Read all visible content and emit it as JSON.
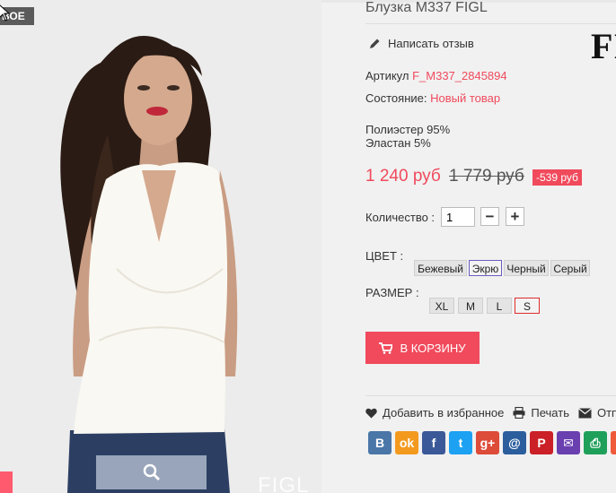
{
  "photo": {
    "badge": "ВОЕ",
    "watermark": "FIGL"
  },
  "product": {
    "title": "Блузка M337 FIGL",
    "brand_logo": "FI",
    "review_label": "Написать отзыв",
    "article_label": "Артикул",
    "article_value": "F_M337_2845894",
    "condition_label": "Состояние:",
    "condition_value": "Новый товар",
    "composition_1": "Полиэстер 95%",
    "composition_2": "Эластан 5%",
    "price_new": "1 240 руб",
    "price_old": "1 779 руб",
    "discount": "-539 руб",
    "qty_label": "Количество :",
    "qty_value": "1",
    "qty_minus": "−",
    "qty_plus": "+",
    "color_label": "ЦВЕТ :",
    "colors": [
      "Бежевый",
      "Экрю",
      "Черный",
      "Серый"
    ],
    "selected_color": "Экрю",
    "size_label": "РАЗМЕР :",
    "sizes": [
      "XL",
      "M",
      "L",
      "S"
    ],
    "selected_size": "S",
    "cart_label": "В КОРЗИНУ"
  },
  "actions": {
    "favorite": "Добавить в избранное",
    "print": "Печать",
    "send": "Отпр"
  },
  "social": [
    {
      "icon": "vk-icon",
      "glyph": "B",
      "color": "#4a76a8"
    },
    {
      "icon": "odnoklassniki-icon",
      "glyph": "ok",
      "color": "#f39a1e"
    },
    {
      "icon": "facebook-icon",
      "glyph": "f",
      "color": "#3b5998"
    },
    {
      "icon": "twitter-icon",
      "glyph": "t",
      "color": "#1da1f2"
    },
    {
      "icon": "google-plus-icon",
      "glyph": "g+",
      "color": "#dd4b39"
    },
    {
      "icon": "mail-ru-icon",
      "glyph": "@",
      "color": "#2c5e9e"
    },
    {
      "icon": "pinterest-icon",
      "glyph": "P",
      "color": "#cb2027"
    },
    {
      "icon": "email-icon",
      "glyph": "✉",
      "color": "#6a3fb0"
    },
    {
      "icon": "print-icon",
      "glyph": "⎙",
      "color": "#1fa05a"
    },
    {
      "icon": "more-icon",
      "glyph": "+",
      "color": "#ef5a3a"
    }
  ],
  "colors": {
    "accent": "#f04a5c",
    "selected_color_border": "#6a5fc1",
    "selected_size_border": "#e02a2a"
  }
}
